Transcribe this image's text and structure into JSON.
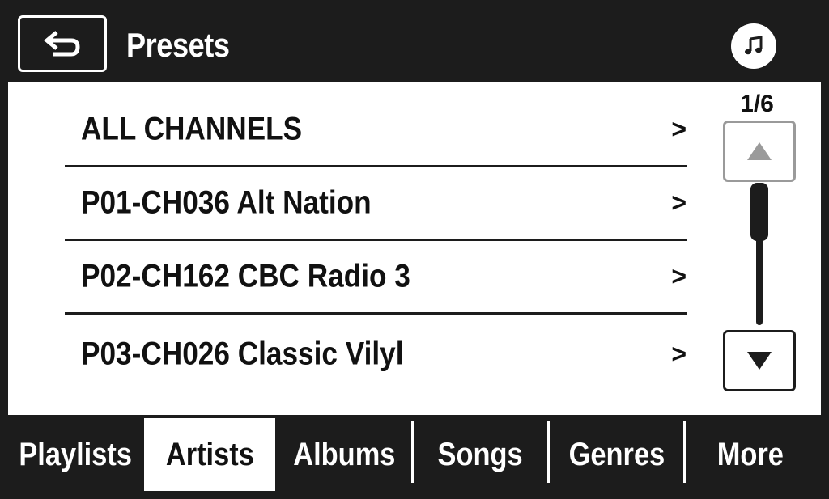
{
  "header": {
    "title": "Presets",
    "back_icon": "back-arrow-icon",
    "music_icon": "music-note-icon"
  },
  "list": {
    "items": [
      {
        "label": "ALL CHANNELS",
        "chevron": ">"
      },
      {
        "label": "P01-CH036 Alt Nation",
        "chevron": ">"
      },
      {
        "label": "P02-CH162 CBC Radio 3",
        "chevron": ">"
      },
      {
        "label": "P03-CH026 Classic Vilyl",
        "chevron": ">"
      }
    ]
  },
  "scroll": {
    "page_indicator": "1/6",
    "up_icon": "triangle-up-icon",
    "down_icon": "triangle-down-icon",
    "position_fraction": 0.0
  },
  "tabs": {
    "items": [
      {
        "label": "Playlists",
        "active": false
      },
      {
        "label": "Artists",
        "active": true
      },
      {
        "label": "Albums",
        "active": false
      },
      {
        "label": "Songs",
        "active": false
      },
      {
        "label": "Genres",
        "active": false
      },
      {
        "label": "More",
        "active": false
      }
    ]
  },
  "colors": {
    "background_dark": "#1c1c1c",
    "list_background": "#ffffff",
    "disabled_border": "#9a9a9a"
  }
}
